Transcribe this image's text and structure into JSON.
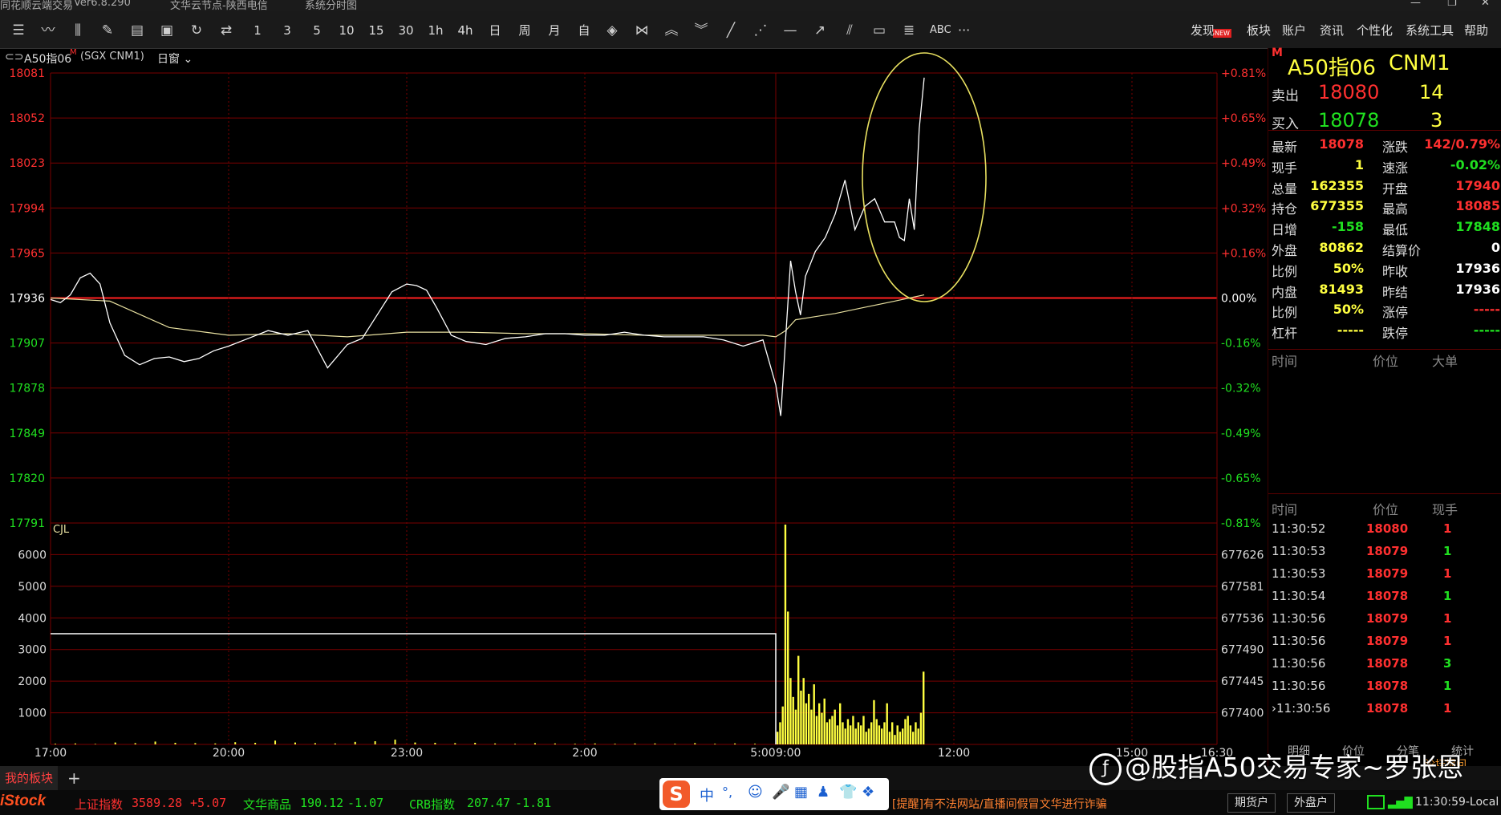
{
  "window": {
    "app_name": "同花顺云端交易",
    "version": "Ver6.8.290",
    "server": "文华云节点-陕西电信",
    "window_title": "系统分时图"
  },
  "toolbar": {
    "left_icons": [
      "list-icon",
      "line-chart-icon",
      "candle-icon",
      "tool-icon",
      "grid-icon",
      "save-icon",
      "refresh-icon",
      "compare-icon"
    ],
    "periods": [
      "1",
      "3",
      "5",
      "10",
      "15",
      "30",
      "1h",
      "4h",
      "日",
      "周",
      "月",
      "自"
    ],
    "draw_icons": [
      "diamond-icon",
      "bowtie-icon",
      "up-chevron-icon",
      "down-chevron-icon",
      "line-icon",
      "dotline-icon",
      "hline-icon",
      "arrowline-icon",
      "channel-icon",
      "rect-icon",
      "text-icon"
    ],
    "abc": "ABC",
    "more": "···",
    "right_menu": [
      "发现",
      "板块",
      "账户",
      "资讯",
      "个性化",
      "系统工具",
      "帮助"
    ],
    "new_badge": "NEW"
  },
  "chart_header": {
    "symbol": "A50指06",
    "superscript": "M",
    "code": "(SGX CNM1)",
    "period": "日窗"
  },
  "chart_data": [
    {
      "type": "line",
      "title": "",
      "y_ticks": [
        "18081",
        "18052",
        "18023",
        "17994",
        "17965",
        "17936",
        "17907",
        "17878",
        "17849",
        "17820",
        "17791"
      ],
      "y_ticks_right": [
        "+0.81%",
        "+0.65%",
        "+0.49%",
        "+0.32%",
        "+0.16%",
        "0.00%",
        "-0.16%",
        "-0.32%",
        "-0.49%",
        "-0.65%",
        "-0.81%"
      ],
      "ylim": [
        17791,
        18081
      ],
      "reference": 17936,
      "x_ticks": [
        "17:00",
        "20:00",
        "23:00",
        "2:00",
        "5:00",
        "9:00",
        "12:00",
        "15:00",
        "16:30"
      ],
      "series": [
        {
          "name": "",
          "color": "#ffffff",
          "x": [
            "17:00",
            "17:10",
            "17:20",
            "17:30",
            "17:40",
            "17:50",
            "18:00",
            "18:15",
            "18:30",
            "18:45",
            "19:00",
            "19:15",
            "19:30",
            "19:45",
            "20:00",
            "20:20",
            "20:40",
            "21:00",
            "21:20",
            "21:40",
            "22:00",
            "22:15",
            "22:30",
            "22:45",
            "23:00",
            "23:10",
            "23:20",
            "23:30",
            "23:45",
            "0:00",
            "0:20",
            "0:40",
            "1:00",
            "1:20",
            "1:40",
            "2:00",
            "2:20",
            "2:40",
            "3:00",
            "3:20",
            "3:40",
            "4:00",
            "4:20",
            "4:40",
            "5:00",
            "9:00",
            "9:05",
            "9:10",
            "9:15",
            "9:20",
            "9:25",
            "9:30",
            "9:40",
            "9:50",
            "10:00",
            "10:10",
            "10:20",
            "10:30",
            "10:40",
            "10:50",
            "11:00",
            "11:05",
            "11:10",
            "11:15",
            "11:20",
            "11:25",
            "11:30"
          ],
          "values": [
            17935,
            17933,
            17938,
            17949,
            17952,
            17945,
            17920,
            17899,
            17893,
            17897,
            17898,
            17895,
            17897,
            17902,
            17905,
            17910,
            17915,
            17912,
            17915,
            17891,
            17906,
            17910,
            17925,
            17940,
            17945,
            17944,
            17941,
            17930,
            17912,
            17908,
            17906,
            17910,
            17911,
            17913,
            17913,
            17912,
            17912,
            17914,
            17912,
            17911,
            17911,
            17911,
            17909,
            17905,
            17909,
            17880,
            17860,
            17910,
            17960,
            17940,
            17925,
            17950,
            17966,
            17975,
            17990,
            18012,
            17980,
            17995,
            18000,
            17985,
            17985,
            17975,
            17973,
            18000,
            17980,
            18045,
            18078
          ]
        },
        {
          "name": "",
          "color": "#e8e0a0",
          "x": [
            "17:00",
            "18:00",
            "19:00",
            "20:00",
            "21:00",
            "22:00",
            "23:00",
            "0:00",
            "1:00",
            "2:00",
            "3:00",
            "4:00",
            "5:00",
            "9:00",
            "9:10",
            "9:20",
            "9:40",
            "10:00",
            "10:30",
            "11:00",
            "11:30"
          ],
          "values": [
            17936,
            17934,
            17917,
            17912,
            17913,
            17911,
            17914,
            17914,
            17913,
            17913,
            17912,
            17912,
            17912,
            17911,
            17915,
            17922,
            17924,
            17926,
            17930,
            17934,
            17938
          ]
        }
      ]
    },
    {
      "type": "bar",
      "title": "CJL",
      "y_ticks": [
        "6000",
        "5000",
        "4000",
        "3000",
        "2000",
        "1000"
      ],
      "y_ticks_right": [
        "677626",
        "677581",
        "677536",
        "677490",
        "677445",
        "677400"
      ],
      "ylim": [
        0,
        7000
      ],
      "open_interest_level": 3500,
      "series": [
        {
          "name": "成交量 night",
          "values": [
            20,
            30,
            15,
            60,
            40,
            90,
            50,
            40,
            30,
            70,
            50,
            120,
            60,
            40,
            30,
            80,
            100,
            150,
            60,
            50,
            40,
            50,
            30,
            20,
            40,
            30,
            20,
            30,
            20,
            30,
            30,
            20,
            40,
            20,
            30,
            20
          ]
        },
        {
          "name": "成交量 day",
          "values": [
            400,
            700,
            1200,
            6950,
            4200,
            2100,
            1500,
            1100,
            2800,
            1700,
            2100,
            1300,
            1600,
            1100,
            1900,
            900,
            1300,
            1000,
            1450,
            700,
            800,
            900,
            1100,
            600,
            1300,
            700,
            500,
            800,
            600,
            900,
            500,
            700,
            600,
            900,
            400,
            500,
            700,
            1400,
            800,
            600,
            500,
            700,
            1300,
            400,
            700,
            300,
            600,
            400,
            500,
            800,
            900,
            600,
            400,
            700,
            500,
            1000,
            2300
          ]
        }
      ]
    }
  ],
  "quote": {
    "title_symbol": "A50指06",
    "title_code": "CNM1",
    "title_m": "M",
    "sell_label": "卖出",
    "sell_price": "18080",
    "sell_qty": "14",
    "buy_label": "买入",
    "buy_price": "18078",
    "buy_qty": "3",
    "fields": [
      {
        "label": "最新",
        "value": "18078",
        "label2": "涨跌",
        "value2": "142/0.79%"
      },
      {
        "label": "现手",
        "value": "1",
        "label2": "速涨",
        "value2": "-0.02%"
      },
      {
        "label": "总量",
        "value": "162355",
        "label2": "开盘",
        "value2": "17940"
      },
      {
        "label": "持仓",
        "value": "677355",
        "label2": "最高",
        "value2": "18085"
      },
      {
        "label": "日增",
        "value": "-158",
        "label2": "最低",
        "value2": "17848"
      },
      {
        "label": "外盘",
        "value": "80862",
        "label2": "结算价",
        "value2": "0"
      },
      {
        "label": "比例",
        "value": "50%",
        "label2": "昨收",
        "value2": "17936"
      },
      {
        "label": "内盘",
        "value": "81493",
        "label2": "昨结",
        "value2": "17936"
      },
      {
        "label": "比例",
        "value": "50%",
        "label2": "涨停",
        "value2": "-----"
      },
      {
        "label": "杠杆",
        "value": "-----",
        "label2": "跌停",
        "value2": "-----"
      }
    ],
    "big_orders_headers": [
      "时间",
      "价位",
      "大单"
    ],
    "ticks_headers": [
      "时间",
      "价位",
      "现手"
    ],
    "ticks": [
      {
        "time": "11:30:52",
        "price": "18080",
        "qty": "1"
      },
      {
        "time": "11:30:53",
        "price": "18079",
        "qty": "1"
      },
      {
        "time": "11:30:53",
        "price": "18079",
        "qty": "1"
      },
      {
        "time": "11:30:54",
        "price": "18078",
        "qty": "1"
      },
      {
        "time": "11:30:56",
        "price": "18079",
        "qty": "1"
      },
      {
        "time": "11:30:56",
        "price": "18079",
        "qty": "1"
      },
      {
        "time": "11:30:56",
        "price": "18078",
        "qty": "3"
      },
      {
        "time": "11:30:56",
        "price": "18078",
        "qty": "1"
      },
      {
        "time": "11:30:56",
        "price": "18078",
        "qty": "1"
      }
    ],
    "bottom_tabs": [
      "明细",
      "价位",
      "分笔",
      "统计"
    ],
    "forum_link": "论坛提问"
  },
  "bottombar": {
    "my_sector": "我的板块",
    "add": "+"
  },
  "statusbar": {
    "logo": "iStock",
    "index1_name": "上证指数",
    "index1_value": "3589.28",
    "index1_change": "+5.07",
    "index2_name": "文华商品",
    "index2_value": "190.12",
    "index2_change": "-1.07",
    "index3_name": "CRB指数",
    "index3_value": "207.47",
    "index3_change": "-1.81",
    "warning": "[提醒]有不法网站/直播间假冒文华进行诈骗",
    "futures_account": "期货户",
    "external_account": "外盘户",
    "time": "11:30:59-Local"
  },
  "ime": {
    "label": "中",
    "punct": "°,"
  },
  "watermark": "@股指A50交易专家~罗张恩",
  "colors": {
    "red": "#ff3030",
    "green": "#20e020",
    "yellow": "#ffff40",
    "grid": "#7a0000",
    "price_line": "#ffffff",
    "avg_line": "#e8e0a0",
    "ellipse": "#e8e060"
  }
}
